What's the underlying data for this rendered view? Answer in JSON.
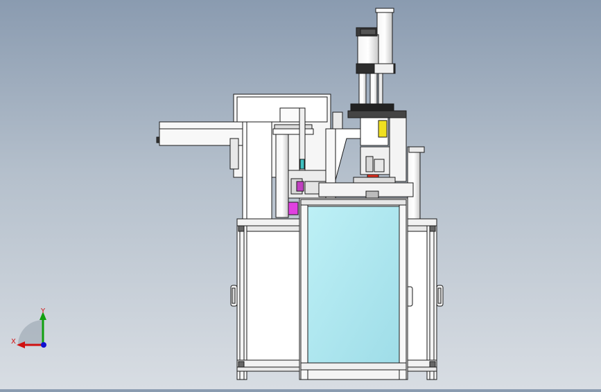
{
  "viewport": {
    "triad": {
      "x_label": "X",
      "y_label": "Y",
      "x_color": "#d01010",
      "y_color": "#10a010",
      "z_color": "#1010d0"
    },
    "colors": {
      "background_top": "#8a9bb0",
      "background_bottom": "#d8dde3",
      "frame": "#ffffff",
      "outline": "#1a1a1a",
      "glass_panel": "#a8e6ee",
      "highlight_magenta": "#e040e0",
      "highlight_yellow": "#f0e020",
      "highlight_red": "#e03020"
    }
  }
}
